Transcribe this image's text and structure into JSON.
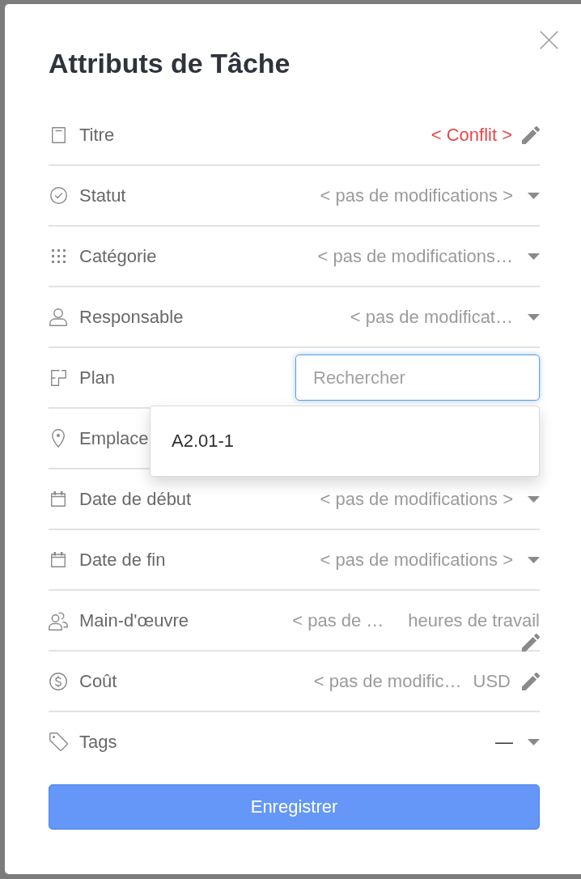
{
  "dialog": {
    "title": "Attributs de Tâche"
  },
  "fields": [
    {
      "kind": "edit",
      "label": "Titre",
      "value": "< Conflit >",
      "conflict": true
    },
    {
      "kind": "select",
      "label": "Statut",
      "placeholder": "< pas de modifications >",
      "conflict": false
    },
    {
      "kind": "select",
      "label": "Catégorie",
      "placeholder": "< pas de modifications…",
      "conflict": false
    },
    {
      "kind": "select",
      "label": "Responsable",
      "placeholder": "< pas de modificat…",
      "conflict": false
    },
    {
      "kind": "search",
      "label": "Plan",
      "placeholder": "Rechercher",
      "focused": true,
      "suggestions": [
        {
          "label": "A2.01-1",
          "selected": false
        }
      ]
    },
    {
      "kind": "plain",
      "label": "Emplace"
    },
    {
      "kind": "select",
      "label": "Date de début",
      "placeholder": "< pas de modifications >",
      "conflict": false
    },
    {
      "kind": "select",
      "label": "Date de fin",
      "placeholder": "< pas de modifications >",
      "conflict": false
    },
    {
      "kind": "stacked",
      "label": "Main-d'œuvre",
      "placeholder": "< pas de …",
      "unit": "heures de travail",
      "conflict": false
    },
    {
      "kind": "unit",
      "label": "Coût",
      "placeholder": "< pas de modific…",
      "unit": "USD",
      "conflict": false
    },
    {
      "kind": "tags",
      "label": "Tags",
      "value": "—"
    }
  ],
  "save_button": "Enregistrer"
}
